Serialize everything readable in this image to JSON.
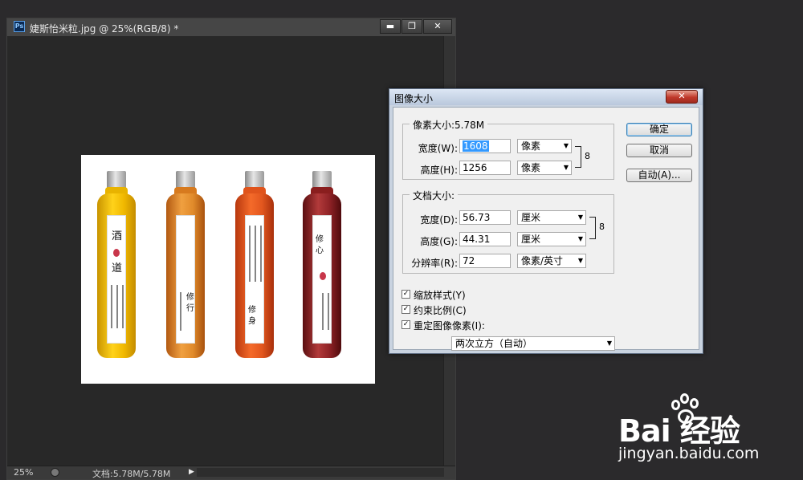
{
  "document": {
    "title": "婕斯怡米粒.jpg @ 25%(RGB/8) *",
    "app_icon_text": "Ps",
    "controls": {
      "minimize": "▬",
      "restore": "❐",
      "close": "✕"
    },
    "status": {
      "zoom": "25%",
      "doc_info": "文档:5.78M/5.78M",
      "arrow": "▶"
    },
    "image_labels": {
      "bottle1": [
        "酒",
        "道"
      ],
      "bottle2": [
        "修",
        "行"
      ],
      "bottle3": [
        "修",
        "身"
      ],
      "bottle4": [
        "修",
        "心"
      ]
    }
  },
  "dialog": {
    "title": "图像大小",
    "close_label": "✕",
    "pixel_dims": {
      "title": "像素大小:5.78M",
      "width_label": "宽度(W):",
      "width_value_selected": "1608",
      "width_unit": "像素",
      "height_label": "高度(H):",
      "height_value": "1256",
      "height_unit": "像素"
    },
    "doc_size": {
      "title": "文档大小:",
      "width_label": "宽度(D):",
      "width_value": "56.73",
      "width_unit": "厘米",
      "height_label": "高度(G):",
      "height_value": "44.31",
      "height_unit": "厘米",
      "res_label": "分辨率(R):",
      "res_value": "72",
      "res_unit": "像素/英寸"
    },
    "options": {
      "scale_styles": "缩放样式(Y)",
      "constrain": "约束比例(C)",
      "resample": "重定图像像素(I):",
      "resample_method": "两次立方（自动）",
      "check": "✓"
    },
    "buttons": {
      "ok": "确定",
      "cancel": "取消",
      "auto": "自动(A)..."
    },
    "link_icon": "8",
    "dropdown_arrow": "▼"
  },
  "watermark": {
    "brand": "Bai  经验",
    "url": "jingyan.baidu.com"
  }
}
